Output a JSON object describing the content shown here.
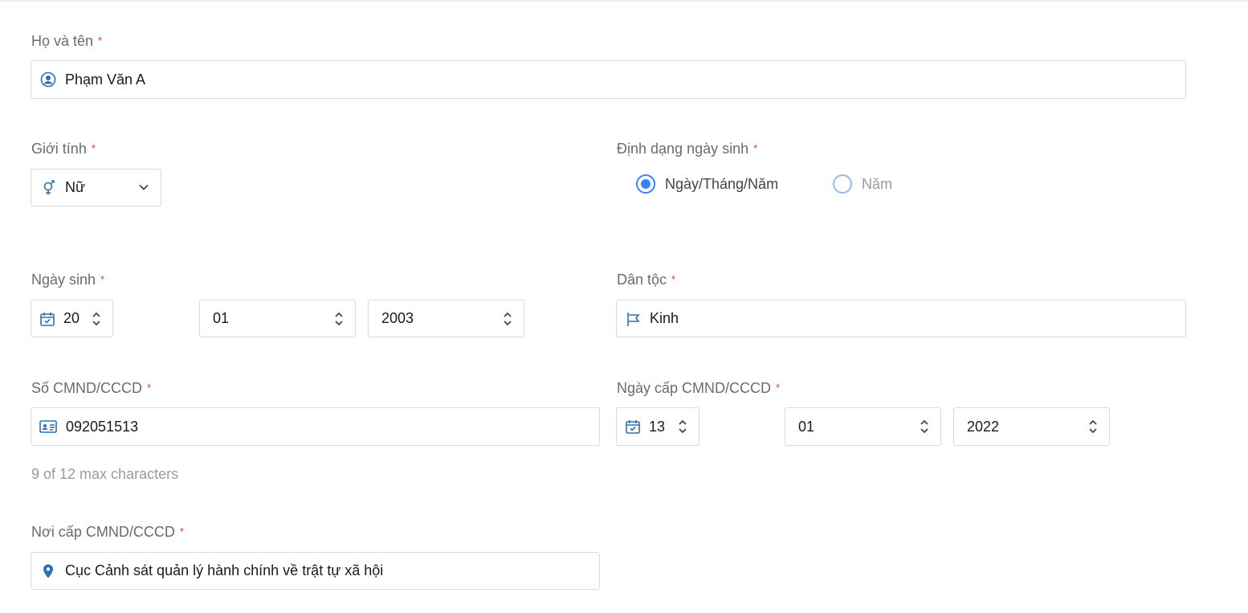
{
  "form": {
    "full_name": {
      "label": "Họ và tên",
      "required_mark": "*",
      "value": "Phạm Văn A",
      "icon": "user-circle-icon"
    },
    "gender": {
      "label": "Giới tính",
      "required_mark": "*",
      "value": "Nữ",
      "icon": "gender-icon"
    },
    "dob_format": {
      "label": "Định dạng ngày sinh",
      "required_mark": "*",
      "options": [
        {
          "label": "Ngày/Tháng/Năm",
          "selected": true
        },
        {
          "label": "Năm",
          "selected": false
        }
      ]
    },
    "dob": {
      "label": "Ngày sinh",
      "required_mark": "*",
      "day": "20",
      "month": "01",
      "year": "2003",
      "icon": "calendar-icon"
    },
    "ethnicity": {
      "label": "Dân tộc",
      "required_mark": "*",
      "value": "Kinh",
      "icon": "flag-icon"
    },
    "id_number": {
      "label": "Số CMND/CCCD",
      "required_mark": "*",
      "value": "092051513",
      "helper": "9 of 12 max characters",
      "icon": "id-card-icon"
    },
    "id_issue_date": {
      "label": "Ngày cấp CMND/CCCD",
      "required_mark": "*",
      "day": "13",
      "month": "01",
      "year": "2022",
      "icon": "calendar-icon"
    },
    "id_issue_place": {
      "label": "Nơi cấp CMND/CCCD",
      "required_mark": "*",
      "value": "Cục Cảnh sát quản lý hành chính về trật tự xã hội",
      "icon": "location-pin-icon"
    }
  },
  "colors": {
    "accent": "#3b82f6",
    "required": "#e53935",
    "icon": "#2f6fb3"
  }
}
